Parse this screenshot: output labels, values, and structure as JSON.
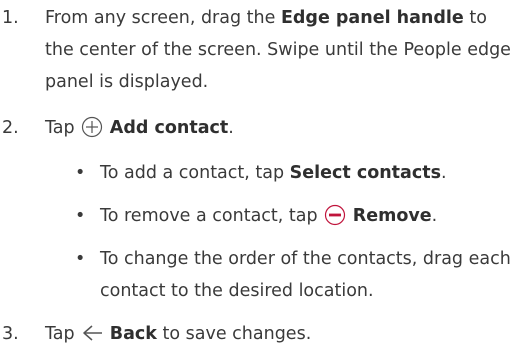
{
  "steps": [
    {
      "num": "1.",
      "pre": "From any screen, drag the ",
      "bold": "Edge panel handle",
      "post": " to the center of the screen. Swipe until the People edge panel is displayed."
    },
    {
      "num": "2.",
      "pre": "Tap ",
      "icon": "add-circle-icon",
      "bold": "Add contact",
      "post": "."
    },
    {
      "num": "3.",
      "pre": "Tap ",
      "icon": "back-arrow-icon",
      "bold": "Back",
      "post": " to save changes."
    }
  ],
  "bullets": [
    {
      "pre": "To add a contact, tap ",
      "bold": "Select contacts",
      "post": "."
    },
    {
      "pre": "To remove a contact, tap ",
      "icon": "remove-circle-icon",
      "bold": "Remove",
      "post": "."
    },
    {
      "pre": "To change the order of the contacts, drag each contact to the desired location."
    }
  ],
  "bullet_char": "•",
  "colors": {
    "text": "#3a3a3a",
    "remove_icon": "#c0143c",
    "icon_stroke": "#555555"
  }
}
